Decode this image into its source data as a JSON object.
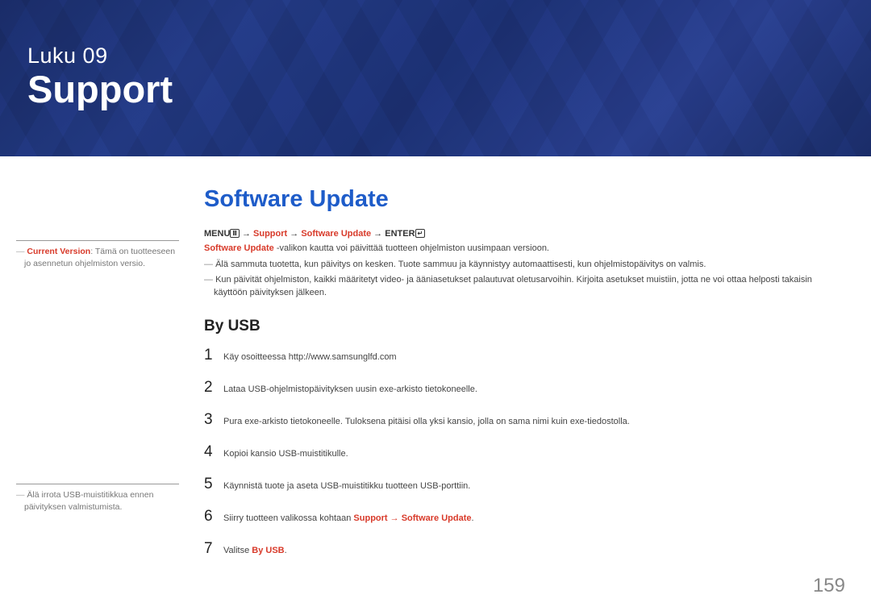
{
  "banner": {
    "chapter_label": "Luku 09",
    "chapter_title": "Support"
  },
  "section_title": "Software Update",
  "menu_path": {
    "prefix": "MENU",
    "menu_icon": "Ⅲ",
    "arrow": " → ",
    "p1": "Support",
    "p2": "Software Update",
    "suffix": "ENTER",
    "enter_icon": "↵"
  },
  "intro": {
    "strong": "Software Update",
    "rest": " -valikon kautta voi päivittää tuotteen ohjelmiston uusimpaan versioon."
  },
  "dashes": [
    "Älä sammuta tuotetta, kun päivitys on kesken. Tuote sammuu ja käynnistyy automaattisesti, kun ohjelmistopäivitys on valmis.",
    "Kun päivität ohjelmiston, kaikki määritetyt video- ja ääniasetukset palautuvat oletusarvoihin. Kirjoita asetukset muistiin, jotta ne voi ottaa helposti takaisin käyttöön päivityksen jälkeen."
  ],
  "sidebar": {
    "note1_accent": "Current Version",
    "note1_rest": ": Tämä on tuotteeseen jo asennetun ohjelmiston versio.",
    "note2": "Älä irrota USB-muistitikkua ennen päivityksen valmistumista."
  },
  "subheading": "By USB",
  "steps": [
    {
      "n": "1",
      "text": "Käy osoitteessa http://www.samsunglfd.com"
    },
    {
      "n": "2",
      "text": "Lataa USB-ohjelmistopäivityksen uusin exe-arkisto tietokoneelle."
    },
    {
      "n": "3",
      "text": "Pura exe-arkisto tietokoneelle. Tuloksena pitäisi olla yksi kansio, jolla on sama nimi kuin exe-tiedostolla."
    },
    {
      "n": "4",
      "text": "Kopioi kansio USB-muistitikulle."
    },
    {
      "n": "5",
      "text": "Käynnistä tuote ja aseta USB-muistitikku tuotteen USB-porttiin."
    },
    {
      "n": "6",
      "pre": "Siirry tuotteen valikossa kohtaan ",
      "accent": "Support → Software Update",
      "post": "."
    },
    {
      "n": "7",
      "pre": "Valitse ",
      "accent": "By USB",
      "post": "."
    }
  ],
  "page_number": "159"
}
